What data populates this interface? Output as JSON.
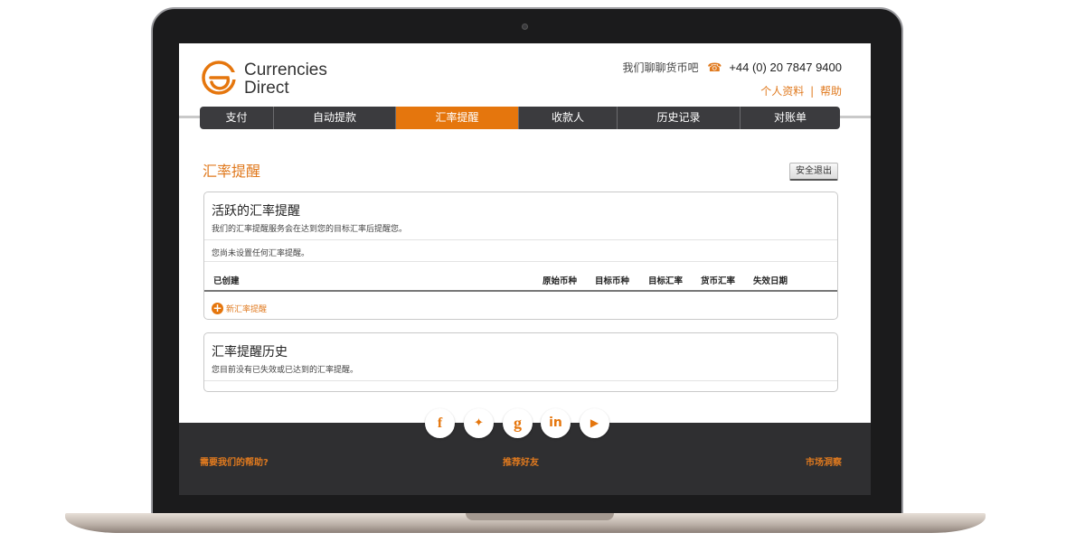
{
  "brand": {
    "name_line1": "Currencies",
    "name_line2": "Direct",
    "accent_color": "#e5760d"
  },
  "header": {
    "chat_text": "我们聊聊货币吧",
    "phone_icon": "phone-icon",
    "phone": "+44 (0) 20 7847 9400",
    "profile_link": "个人资料",
    "separator": "|",
    "help_link": "帮助"
  },
  "nav": {
    "tabs": [
      {
        "label": "支付"
      },
      {
        "label": "自动提款"
      },
      {
        "label": "汇率提醒"
      },
      {
        "label": "收款人"
      },
      {
        "label": "历史记录"
      },
      {
        "label": "对账单"
      }
    ],
    "active_index": 2
  },
  "page": {
    "title": "汇率提醒",
    "logout_label": "安全退出"
  },
  "active_alerts": {
    "heading": "活跃的汇率提醒",
    "description": "我们的汇率提醒服务会在达到您的目标汇率后提醒您。",
    "empty_note": "您尚未设置任何汇率提醒。",
    "columns": [
      "已创建",
      "原始币种",
      "目标币种",
      "目标汇率",
      "货币汇率",
      "失效日期"
    ],
    "add_label": "新汇率提醒",
    "add_icon": "plus-circle-icon"
  },
  "history": {
    "heading": "汇率提醒历史",
    "description": "您目前没有已失效或已达到的汇率提醒。"
  },
  "footer": {
    "social": [
      {
        "icon": "facebook-icon",
        "glyph": "f"
      },
      {
        "icon": "twitter-icon",
        "glyph": "✦"
      },
      {
        "icon": "google-plus-icon",
        "glyph": "g"
      },
      {
        "icon": "linkedin-icon",
        "glyph": "in"
      },
      {
        "icon": "youtube-icon",
        "glyph": "▶"
      }
    ],
    "help_link": "需要我们的帮助?",
    "refer_link": "推荐好友",
    "insight_link": "市场洞察"
  }
}
